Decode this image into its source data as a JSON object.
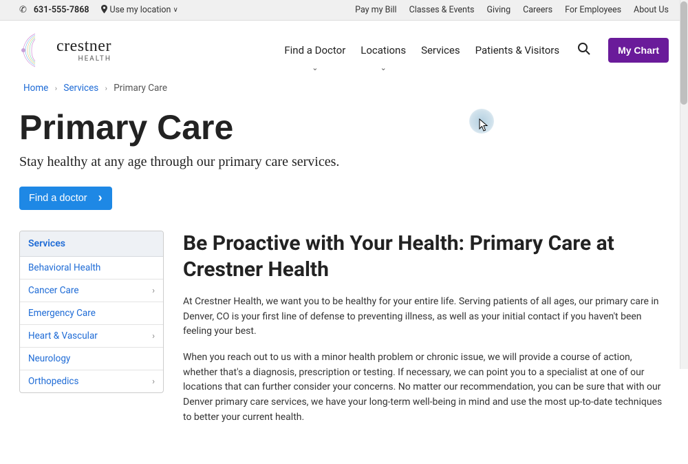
{
  "topbar": {
    "phone": "631-555-7868",
    "location_label": "Use my location",
    "links": [
      "Pay my Bill",
      "Classes & Events",
      "Giving",
      "Careers",
      "For Employees",
      "About Us"
    ]
  },
  "logo": {
    "name": "crestner",
    "sub": "HEALTH"
  },
  "nav": {
    "items": [
      {
        "label": "Find a Doctor",
        "dropdown": true
      },
      {
        "label": "Locations",
        "dropdown": true
      },
      {
        "label": "Services",
        "dropdown": false
      },
      {
        "label": "Patients & Visitors",
        "dropdown": false
      }
    ],
    "mychart": "My Chart"
  },
  "breadcrumb": {
    "items": [
      {
        "label": "Home",
        "link": true
      },
      {
        "label": "Services",
        "link": true
      },
      {
        "label": "Primary Care",
        "link": false
      }
    ]
  },
  "hero": {
    "title": "Primary Care",
    "subtitle": "Stay healthy at any age through our primary care services.",
    "cta": "Find a doctor"
  },
  "sidebar": {
    "heading": "Services",
    "items": [
      {
        "label": "Behavioral Health",
        "expand": false
      },
      {
        "label": "Cancer Care",
        "expand": true
      },
      {
        "label": "Emergency Care",
        "expand": false
      },
      {
        "label": "Heart & Vascular",
        "expand": true
      },
      {
        "label": "Neurology",
        "expand": false
      },
      {
        "label": "Orthopedics",
        "expand": true
      }
    ]
  },
  "main": {
    "heading": "Be Proactive with Your Health: Primary Care at Crestner Health",
    "p1": "At Crestner Health, we want you to be healthy for your entire life. Serving patients of all ages, our primary care in Denver, CO is your first line of defense to preventing illness, as well as your initial contact if you haven't been feeling your best.",
    "p2": "When you reach out to us with a minor health problem or chronic issue, we will provide a course of action, whether that's a diagnosis, prescription or testing. If necessary, we can point you to a specialist at one of our locations that can further consider your concerns. No matter our recommendation, you can be sure that with our Denver primary care services, we have your long-term well-being in mind and use the most up-to-date techniques to better your current health."
  }
}
